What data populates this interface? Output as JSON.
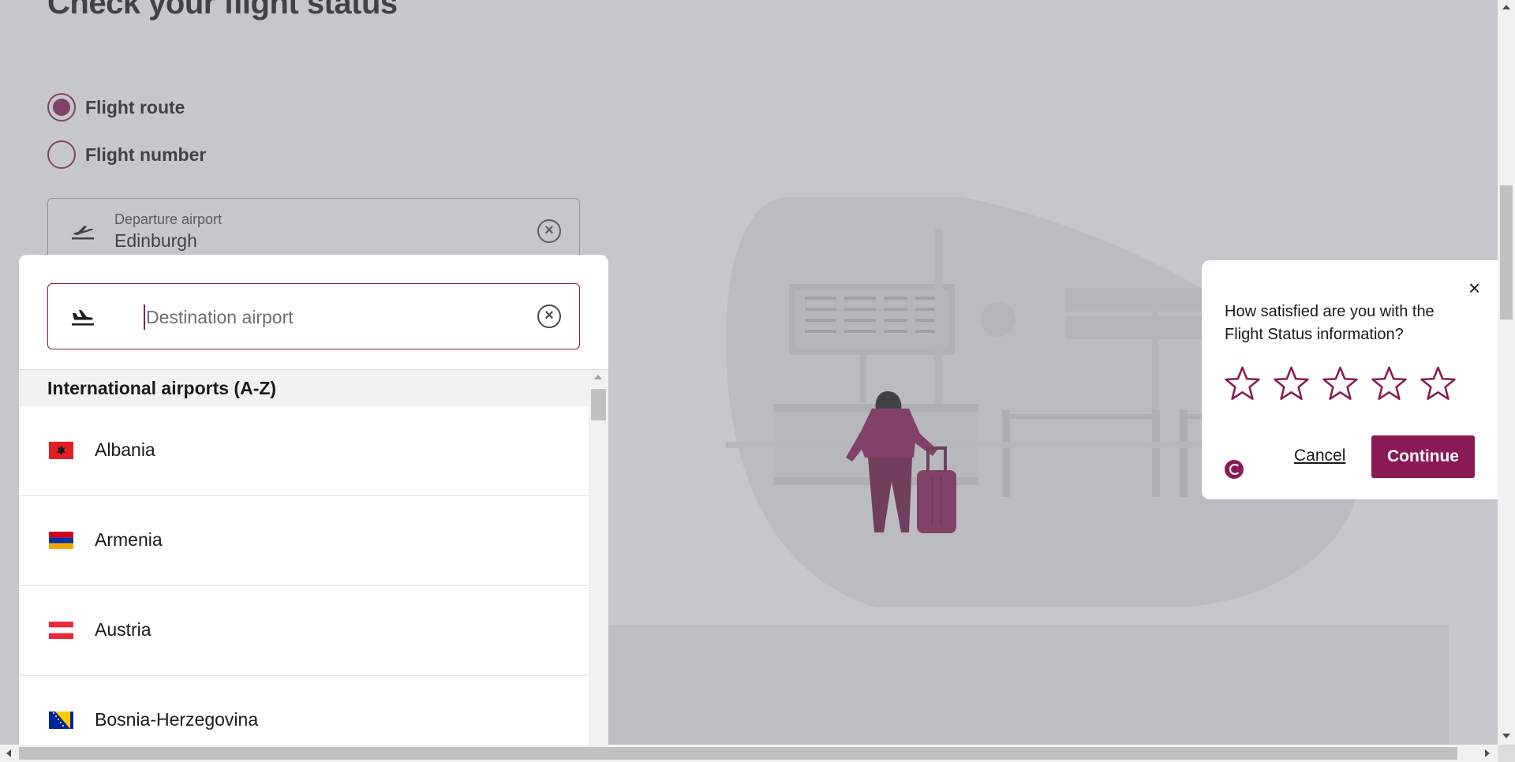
{
  "page": {
    "title": "Check your flight status"
  },
  "search_type": {
    "options": [
      {
        "label": "Flight route",
        "checked": true
      },
      {
        "label": "Flight number",
        "checked": false
      }
    ]
  },
  "departure": {
    "label": "Departure airport",
    "value": "Edinburgh",
    "icon": "plane-takeoff-icon"
  },
  "destination": {
    "placeholder": "Destination airport",
    "value": "",
    "icon": "plane-landing-icon"
  },
  "airport_list": {
    "group_header": "International airports (A-Z)",
    "countries": [
      {
        "name": "Albania",
        "flag": "albania-flag-icon"
      },
      {
        "name": "Armenia",
        "flag": "armenia-flag-icon"
      },
      {
        "name": "Austria",
        "flag": "austria-flag-icon"
      },
      {
        "name": "Bosnia-Herzegovina",
        "flag": "bosnia-herzegovina-flag-icon"
      }
    ]
  },
  "survey": {
    "question": "How satisfied are you with the Flight Status information?",
    "star_count": 5,
    "rating": 0,
    "cancel_label": "Cancel",
    "continue_label": "Continue",
    "close_symbol": "×"
  },
  "colors": {
    "brand": "#8a1a55",
    "overlay": "#787a82",
    "text": "#1a1a1a"
  }
}
